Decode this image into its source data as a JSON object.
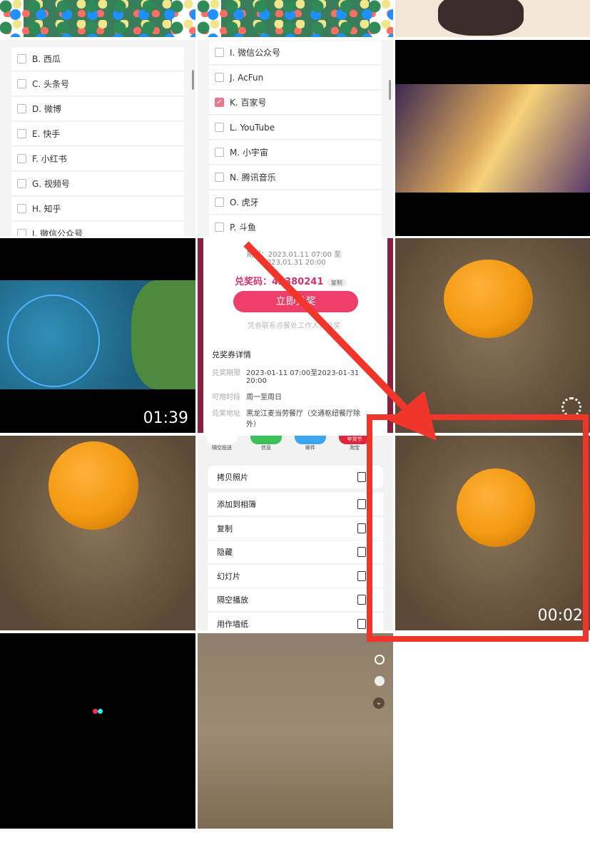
{
  "list_left": [
    "B. 西瓜",
    "C. 头条号",
    "D. 微博",
    "E. 快手",
    "F. 小红书",
    "G. 视频号",
    "H. 知乎",
    "I. 微信公众号"
  ],
  "list_middle": [
    {
      "label": "I. 微信公众号",
      "checked": false
    },
    {
      "label": "J. AcFun",
      "checked": false
    },
    {
      "label": "K. 百家号",
      "checked": true
    },
    {
      "label": "L. YouTube",
      "checked": false
    },
    {
      "label": "M. 小宇宙",
      "checked": false
    },
    {
      "label": "N. 腾讯音乐",
      "checked": false
    },
    {
      "label": "O. 虎牙",
      "checked": false
    },
    {
      "label": "P. 斗鱼",
      "checked": false
    }
  ],
  "videos": {
    "map_duration": "01:39",
    "orange_duration": "00:02"
  },
  "coupon": {
    "validity": "期限：2023.01.11 07:00 至 2023.01.31 20:00",
    "code_label": "兑奖码：4",
    "code": "2380241",
    "copy": "复制",
    "redeem": "立即兑奖",
    "hint": "凭券联系点餐处工作人员兑奖",
    "details_title": "兑奖券详情",
    "rows": [
      {
        "k": "兑奖期限",
        "v": "2023-01-11 07:00至2023-01-31 20:00"
      },
      {
        "k": "可用时段",
        "v": "周一至周日"
      },
      {
        "k": "兑奖地址",
        "v": "黑龙江麦当劳餐厅（交通枢纽餐厅除外）"
      }
    ]
  },
  "share": {
    "apps": [
      "隔空投送",
      "信息",
      "邮件",
      "淘宝"
    ],
    "taobao_badge": "年货节",
    "actions": [
      "拷贝照片",
      "添加到相簿",
      "复制",
      "隐藏",
      "幻灯片",
      "隔空播放",
      "用作墙纸"
    ]
  },
  "colors": {
    "annotation": "#f0362b",
    "accent": "#e8375e"
  }
}
